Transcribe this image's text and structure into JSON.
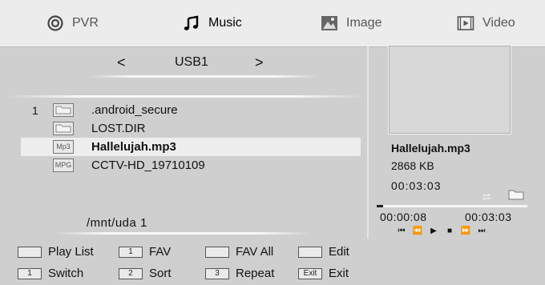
{
  "tabs": [
    {
      "label": "PVR",
      "icon": "pvr-icon",
      "active": false
    },
    {
      "label": "Music",
      "icon": "music-note-icon",
      "active": true
    },
    {
      "label": "Image",
      "icon": "image-icon",
      "active": false
    },
    {
      "label": "Video",
      "icon": "video-icon",
      "active": false
    }
  ],
  "browser": {
    "prev_arrow": "<",
    "source": "USB1",
    "next_arrow": ">",
    "items": [
      {
        "number": "1",
        "icon": "folder-icon",
        "name": ".android_secure",
        "selected": false
      },
      {
        "number": "",
        "icon": "folder-icon",
        "name": "LOST.DIR",
        "selected": false
      },
      {
        "number": "",
        "icon": "mp3-file-icon",
        "badge": "Mp3",
        "name": "Hallelujah.mp3",
        "selected": true
      },
      {
        "number": "",
        "icon": "mpg-file-icon",
        "badge": "MPG",
        "name": "CCTV-HD_19710109",
        "selected": false
      }
    ],
    "path": "/mnt/uda 1"
  },
  "player": {
    "filename": "Hallelujah.mp3",
    "size": "2868 KB",
    "duration": "00:03:03",
    "elapsed": "00:00:08",
    "total": "00:03:03",
    "progress_fraction": 0.044
  },
  "legend": [
    {
      "key": "",
      "label": "Play List"
    },
    {
      "key": "1",
      "label": "FAV"
    },
    {
      "key": "",
      "label": "FAV All"
    },
    {
      "key": "",
      "label": "Edit"
    },
    {
      "key": "1",
      "label": "Switch"
    },
    {
      "key": "2",
      "label": "Sort"
    },
    {
      "key": "3",
      "label": "Repeat"
    },
    {
      "key": "Exit",
      "label": "Exit"
    }
  ],
  "colors": {
    "background": "#cfcfcf",
    "tab_bar": "#ececec",
    "selected_row": "#ededed"
  }
}
